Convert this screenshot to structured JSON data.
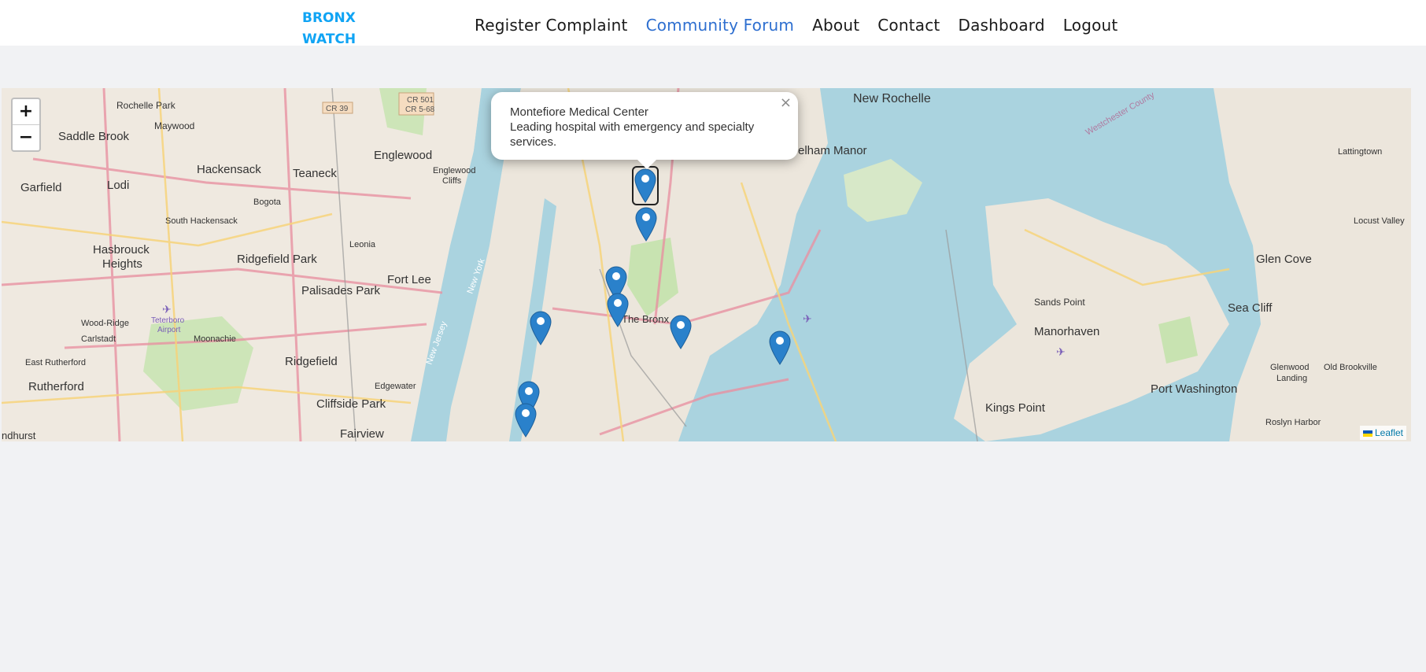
{
  "brand": {
    "line1": "BRONX",
    "line2": "WATCH"
  },
  "nav": {
    "items": [
      {
        "label": "Register Complaint"
      },
      {
        "label": "Community Forum",
        "active": true
      },
      {
        "label": "About"
      },
      {
        "label": "Contact"
      },
      {
        "label": "Dashboard"
      },
      {
        "label": "Logout"
      }
    ]
  },
  "map": {
    "zoom_in_label": "+",
    "zoom_out_label": "−",
    "popup": {
      "title": "Montefiore Medical Center",
      "description": "Leading hospital with emergency and specialty services.",
      "close_label": "×"
    },
    "attribution": "Leaflet",
    "place_labels": [
      "New Rochelle",
      "Pelham Manor",
      "Rochelle Park",
      "Maywood",
      "Saddle Brook",
      "Englewood",
      "Englewood Cliffs",
      "Hackensack",
      "Teaneck",
      "Garfield",
      "Lodi",
      "Bogota",
      "South Hackensack",
      "Hasbrouck Heights",
      "Leonia",
      "Ridgefield Park",
      "Fort Lee",
      "Palisades Park",
      "Wood-Ridge",
      "Carlstadt",
      "Teterboro Airport",
      "Moonachie",
      "East Rutherford",
      "Ridgefield",
      "Rutherford",
      "Edgewater",
      "Cliffside Park",
      "Fairview",
      "The Bronx",
      "Lattingtown",
      "Locust Valley",
      "Glen Cove",
      "Sands Point",
      "Manorhaven",
      "Sea Cliff",
      "Port Washington",
      "Kings Point",
      "Glenwood Landing",
      "Old Brookville",
      "Roslyn Harbor",
      "Westchester County",
      "New York",
      "New Jersey",
      "CR 501",
      "CR 5-68",
      "CR 39"
    ],
    "marker_count": 10
  },
  "colors": {
    "brand": "#10a4f4",
    "nav_active": "#2e6fd0",
    "water": "#aad3df",
    "marker": "#2a81cb"
  }
}
